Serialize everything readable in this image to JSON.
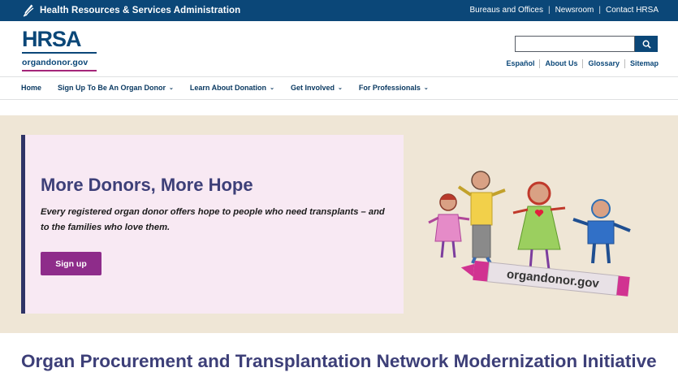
{
  "topbar": {
    "agency_name": "Health Resources & Services Administration",
    "links": [
      "Bureaus and Offices",
      "Newsroom",
      "Contact HRSA"
    ]
  },
  "header": {
    "logo_text": "HRSA",
    "logo_site": "organdonor.gov",
    "search_placeholder": "",
    "utility_links": [
      "Español",
      "About Us",
      "Glossary",
      "Sitemap"
    ]
  },
  "nav": {
    "items": [
      {
        "label": "Home",
        "dropdown": false
      },
      {
        "label": "Sign Up To Be An Organ Donor",
        "dropdown": true
      },
      {
        "label": "Learn About Donation",
        "dropdown": true
      },
      {
        "label": "Get Involved",
        "dropdown": true
      },
      {
        "label": "For Professionals",
        "dropdown": true
      }
    ]
  },
  "hero": {
    "title": "More Donors, More Hope",
    "text": "Every registered organ donor offers hope to people who need transplants – and to the families who love them.",
    "button_label": "Sign up",
    "crayon_label": "organdonor.gov"
  },
  "section": {
    "title": "Organ Procurement and Transplantation Network Modernization Initiative"
  },
  "colors": {
    "brand_blue": "#0b4778",
    "heading_purple": "#3d3f78",
    "accent_magenta": "#8e2c8a",
    "hero_bg": "#efe6d6",
    "card_bg": "#f8e9f3"
  }
}
